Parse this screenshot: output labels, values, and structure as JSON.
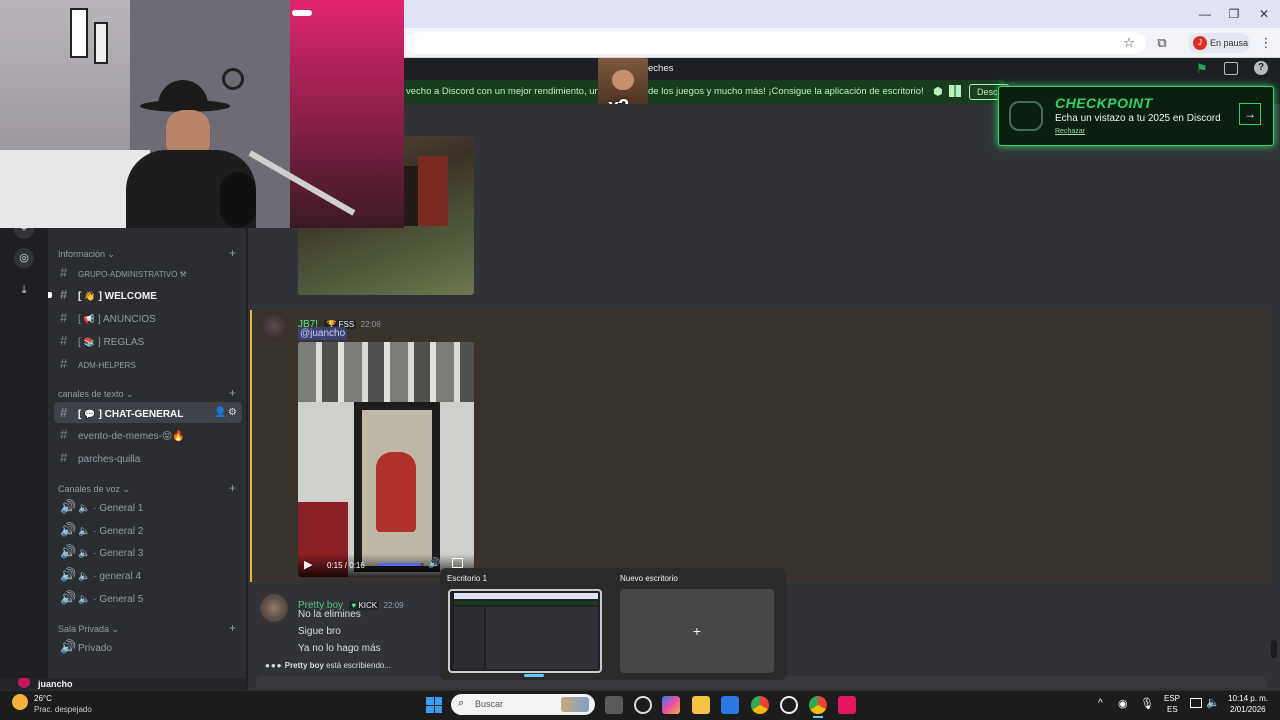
{
  "browser": {
    "profile_initial": "J",
    "profile_status": "En pausa",
    "window_controls": [
      "minimize-icon",
      "maximize-icon",
      "close-icon"
    ]
  },
  "discord": {
    "title_fragment": "eches",
    "banner_text": "vecho a Discord con un mejor rendimiento, un ov",
    "banner_text_2": "de los juegos y mucho más! ¡Consigue la aplicación de escritorio!",
    "banner_button": "Desc",
    "meme_label": "x2",
    "checkpoint": {
      "title": "CHECKPOINT",
      "subtitle": "Echa un vistazo a tu 2025 en Discord",
      "dismiss": "Rechazar"
    },
    "sidebar": {
      "cat_info": "Información",
      "channels_info": [
        {
          "label": "GRUPO-ADMINISTRATIVO",
          "emoji": "⚒"
        },
        {
          "label": "WELCOME",
          "emoji": "👋"
        },
        {
          "label": "ANUNCIOS",
          "emoji": "📢"
        },
        {
          "label": "REGLAS",
          "emoji": "📚"
        },
        {
          "label": "ADM-HELPERS",
          "emoji": ""
        }
      ],
      "cat_text": "canales de texto",
      "channels_text": [
        {
          "label": "CHAT-GENERAL",
          "emoji": "💬"
        },
        {
          "label": "evento-de-memes-",
          "emoji": "😝🔥"
        },
        {
          "label": "parches-quilla",
          "emoji": ""
        }
      ],
      "cat_voice": "Canales de voz",
      "voice": [
        "General 1",
        "General 2",
        "General 3",
        "general 4",
        "General 5"
      ],
      "cat_private": "Sala Privada",
      "private": [
        "Privado"
      ],
      "user_name": "juancho"
    },
    "messages": {
      "m1": {
        "user": "JB7!",
        "tag": "FSS",
        "time": "22:06",
        "mention": "@juancho",
        "video_time": "0:15 / 0:16",
        "video_progress": 0.94
      },
      "m2": {
        "user": "Pretty boy",
        "tag": "KICK",
        "time": "22:09",
        "lines": [
          "No la elimines",
          "Sigue bro",
          "Ya no lo hago más"
        ]
      },
      "typing_user": "Pretty boy",
      "typing_text": "está escribiendo..."
    }
  },
  "taskview": {
    "desktop1": "Escritorio 1",
    "new_desktop": "Nuevo escritorio",
    "plus": "+"
  },
  "taskbar": {
    "weather_temp": "26°C",
    "weather_desc": "Prac. despejado",
    "search_placeholder": "Buscar",
    "lang_1": "ESP",
    "lang_2": "ES",
    "time": "10:14 p. m.",
    "date": "2/01/2026"
  },
  "colors": {
    "discord_bg": "#313338",
    "sidebar_bg": "#2b2d31",
    "accent_green": "#2fd46a",
    "mention_bg": "#3c4270",
    "video_bar": "#5865f2"
  }
}
